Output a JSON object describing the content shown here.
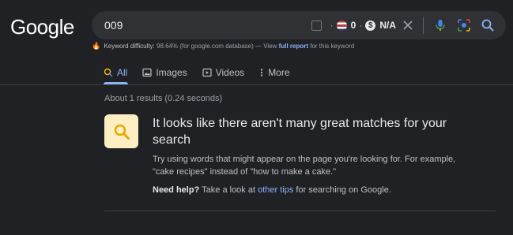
{
  "logo": "Google",
  "search": {
    "query": "009",
    "rank_metric": "0",
    "value_metric": "N/A"
  },
  "keyword_line": {
    "label": "Keyword difficulty:",
    "value": "98.64%",
    "database": "(for google.com database)",
    "sep": "— View",
    "link": "full report",
    "suffix": "for this keyword"
  },
  "tabs": [
    {
      "label": "All",
      "icon": "search-icon",
      "active": true
    },
    {
      "label": "Images",
      "icon": "image-icon"
    },
    {
      "label": "Videos",
      "icon": "play-icon"
    },
    {
      "label": "More",
      "icon": "more-vert-icon"
    }
  ],
  "results": {
    "stats": "About 1 results (0.24 seconds)",
    "heading": "It looks like there aren't many great matches for your search",
    "tip": "Try using words that might appear on the page you're looking for. For example, \"cake recipes\" instead of \"how to make a cake.\"",
    "help_label": "Need help?",
    "help_text_1": "Take a look at",
    "help_link": "other tips",
    "help_text_2": "for searching on Google."
  },
  "colors": {
    "background": "#202124",
    "accent": "#8ab4f8",
    "tip_box": "#feefc3"
  }
}
